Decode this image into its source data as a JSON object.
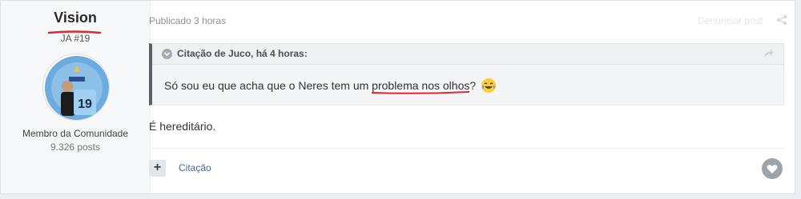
{
  "author": {
    "username": "Vision",
    "rank": "JA #19",
    "group": "Membro da Comunidade",
    "post_count": "9.326 posts",
    "avatar_icon": "manchester-city-avatar"
  },
  "post": {
    "time": "Publicado 3 horas",
    "meta_right": "Denunciar post",
    "quote": {
      "author_line": "Citação de Juco, há 4 horas:",
      "text_before": "Só sou eu que acha que o Neres tem um ",
      "text_highlight": "problema nos olhos",
      "text_after": "?",
      "emoji_icon": "tears-of-joy-emoji"
    },
    "reply_text": "É hereditário.",
    "actions": {
      "plus_label": "+",
      "quote_label": "Citação"
    }
  },
  "colors": {
    "accent_red": "#e3262b",
    "link": "#4c6b8a",
    "sidebar_bg": "#f6f8f9"
  }
}
